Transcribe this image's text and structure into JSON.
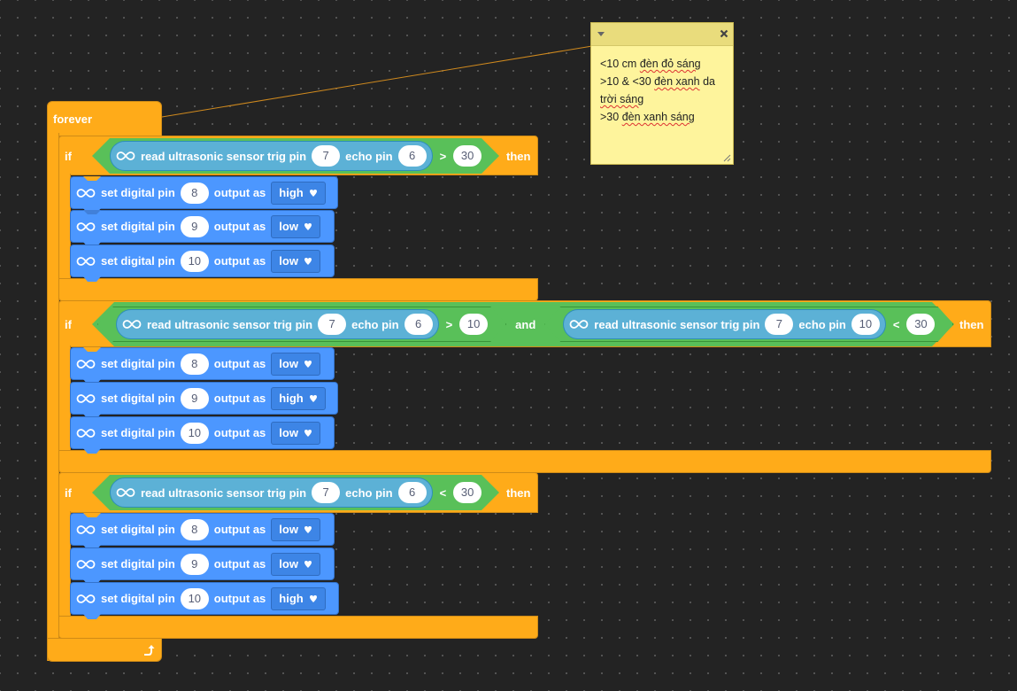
{
  "forever": {
    "label": "forever"
  },
  "if_blocks": [
    {
      "label": "if",
      "then_label": "then",
      "condition": {
        "sensor_label": "read ultrasonic sensor trig pin",
        "trig": "7",
        "echo_label": "echo pin",
        "echo": "6",
        "op": ">",
        "value": "30"
      },
      "actions": [
        {
          "text": "set digital pin",
          "pin": "8",
          "output_label": "output as",
          "state": "high"
        },
        {
          "text": "set digital pin",
          "pin": "9",
          "output_label": "output as",
          "state": "low"
        },
        {
          "text": "set digital pin",
          "pin": "10",
          "output_label": "output as",
          "state": "low"
        }
      ]
    },
    {
      "label": "if",
      "then_label": "then",
      "and_label": "and",
      "condition_a": {
        "sensor_label": "read ultrasonic sensor trig pin",
        "trig": "7",
        "echo_label": "echo pin",
        "echo": "6",
        "op": ">",
        "value": "10"
      },
      "condition_b": {
        "sensor_label": "read ultrasonic sensor trig pin",
        "trig": "7",
        "echo_label": "echo pin",
        "echo": "10",
        "op": "<",
        "value": "30"
      },
      "actions": [
        {
          "text": "set digital pin",
          "pin": "8",
          "output_label": "output as",
          "state": "low"
        },
        {
          "text": "set digital pin",
          "pin": "9",
          "output_label": "output as",
          "state": "high"
        },
        {
          "text": "set digital pin",
          "pin": "10",
          "output_label": "output as",
          "state": "low"
        }
      ]
    },
    {
      "label": "if",
      "then_label": "then",
      "condition": {
        "sensor_label": "read ultrasonic sensor trig pin",
        "trig": "7",
        "echo_label": "echo pin",
        "echo": "6",
        "op": "<",
        "value": "30"
      },
      "actions": [
        {
          "text": "set digital pin",
          "pin": "8",
          "output_label": "output as",
          "state": "low"
        },
        {
          "text": "set digital pin",
          "pin": "9",
          "output_label": "output as",
          "state": "low"
        },
        {
          "text": "set digital pin",
          "pin": "10",
          "output_label": "output as",
          "state": "high"
        }
      ]
    }
  ],
  "note": {
    "lines": [
      {
        "pre": "<10 cm ",
        "sq": "đèn đỏ sáng",
        "post": ""
      },
      {
        "pre": ">10 & <30 ",
        "sq": "đèn xanh",
        "post": " da"
      },
      {
        "pre": "",
        "sq": "trời sáng",
        "post": ""
      },
      {
        "pre": ">30 ",
        "sq": "đèn xanh sáng",
        "post": ""
      }
    ]
  },
  "icons": {
    "arduino": "arduino-infinity-icon",
    "dropdown": "dropdown-arrow-icon",
    "loop": "loop-arrow-icon",
    "note_collapse": "collapse-triangle-icon",
    "note_close": "close-icon",
    "note_resize": "resize-grip-icon"
  },
  "colors": {
    "control": "#ffab19",
    "operator": "#59c059",
    "arduino_block": "#4c97ff",
    "sensor_reporter": "#5cb1d6",
    "note": "#fef49c",
    "workspace": "#232323"
  }
}
